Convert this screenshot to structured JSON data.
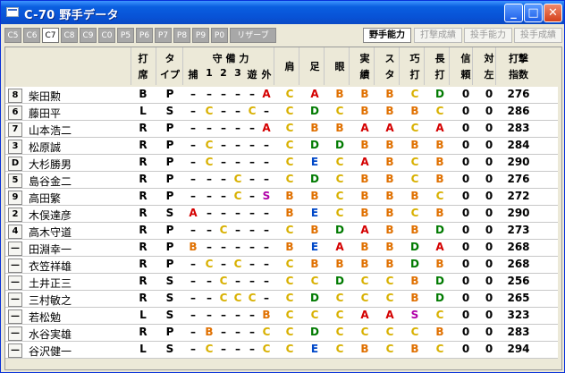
{
  "window": {
    "title": "C-70 野手データ"
  },
  "tabs": [
    "C5",
    "C6",
    "C7",
    "C8",
    "C9",
    "C0",
    "P5",
    "P6",
    "P7",
    "P8",
    "P9",
    "P0",
    "リザーブ"
  ],
  "active_tab": 2,
  "side_buttons": [
    {
      "label": "野手能力",
      "active": true
    },
    {
      "label": "打撃成績",
      "active": false
    },
    {
      "label": "投手能力",
      "active": false
    },
    {
      "label": "投手成績",
      "active": false
    }
  ],
  "headers": {
    "bat_top": "打",
    "bat_bottom": "席",
    "type_top": "タ",
    "type_bottom": "イプ",
    "pos_top": "守 備 力",
    "pos_cols": [
      "捕",
      "1",
      "2",
      "3",
      "遊",
      "外"
    ],
    "shoulder": "肩",
    "leg": "足",
    "eye": "眼",
    "record_top": "実",
    "record_bottom": "績",
    "stamina_top": "ス",
    "stamina_bottom": "タ",
    "skill_top": "巧",
    "skill_bottom": "打",
    "long_top": "長",
    "long_bottom": "打",
    "trust_top": "信",
    "trust_bottom": "頼",
    "vsleft_top": "対",
    "vsleft_bottom": "左",
    "index_top": "打撃",
    "index_bottom": "指数"
  },
  "players": [
    {
      "num": "8",
      "name": "柴田勲",
      "bat": "B",
      "type": "P",
      "pos": [
        "-",
        "-",
        "-",
        "-",
        "-",
        "A"
      ],
      "shoulder": "C",
      "leg": "A",
      "eye": "B",
      "record": "B",
      "stamina": "B",
      "skill": "C",
      "long": "D",
      "trust": "0",
      "vsleft": "0",
      "index": "276"
    },
    {
      "num": "6",
      "name": "藤田平",
      "bat": "L",
      "type": "S",
      "pos": [
        "-",
        "C",
        "-",
        "-",
        "C",
        "-"
      ],
      "shoulder": "C",
      "leg": "D",
      "eye": "C",
      "record": "B",
      "stamina": "B",
      "skill": "B",
      "long": "C",
      "trust": "0",
      "vsleft": "0",
      "index": "286"
    },
    {
      "num": "7",
      "name": "山本浩二",
      "bat": "R",
      "type": "P",
      "pos": [
        "-",
        "-",
        "-",
        "-",
        "-",
        "A"
      ],
      "shoulder": "C",
      "leg": "B",
      "eye": "B",
      "record": "A",
      "stamina": "A",
      "skill": "C",
      "long": "A",
      "trust": "0",
      "vsleft": "0",
      "index": "283"
    },
    {
      "num": "3",
      "name": "松原誠",
      "bat": "R",
      "type": "P",
      "pos": [
        "-",
        "C",
        "-",
        "-",
        "-",
        "-"
      ],
      "shoulder": "C",
      "leg": "D",
      "eye": "D",
      "record": "B",
      "stamina": "B",
      "skill": "B",
      "long": "B",
      "trust": "0",
      "vsleft": "0",
      "index": "284"
    },
    {
      "num": "D",
      "name": "大杉勝男",
      "bat": "R",
      "type": "P",
      "pos": [
        "-",
        "C",
        "-",
        "-",
        "-",
        "-"
      ],
      "shoulder": "C",
      "leg": "E",
      "eye": "C",
      "record": "A",
      "stamina": "B",
      "skill": "C",
      "long": "B",
      "trust": "0",
      "vsleft": "0",
      "index": "290"
    },
    {
      "num": "5",
      "name": "島谷金二",
      "bat": "R",
      "type": "P",
      "pos": [
        "-",
        "-",
        "-",
        "C",
        "-",
        "-"
      ],
      "shoulder": "C",
      "leg": "D",
      "eye": "C",
      "record": "B",
      "stamina": "B",
      "skill": "C",
      "long": "B",
      "trust": "0",
      "vsleft": "0",
      "index": "276"
    },
    {
      "num": "9",
      "name": "高田繁",
      "bat": "R",
      "type": "P",
      "pos": [
        "-",
        "-",
        "-",
        "C",
        "-",
        "S"
      ],
      "shoulder": "B",
      "leg": "B",
      "eye": "C",
      "record": "B",
      "stamina": "B",
      "skill": "B",
      "long": "C",
      "trust": "0",
      "vsleft": "0",
      "index": "272"
    },
    {
      "num": "2",
      "name": "木俣達彦",
      "bat": "R",
      "type": "S",
      "pos": [
        "A",
        "-",
        "-",
        "-",
        "-",
        "-"
      ],
      "shoulder": "B",
      "leg": "E",
      "eye": "C",
      "record": "B",
      "stamina": "B",
      "skill": "C",
      "long": "B",
      "trust": "0",
      "vsleft": "0",
      "index": "290"
    },
    {
      "num": "4",
      "name": "高木守道",
      "bat": "R",
      "type": "P",
      "pos": [
        "-",
        "-",
        "C",
        "-",
        "-",
        "-"
      ],
      "shoulder": "C",
      "leg": "B",
      "eye": "D",
      "record": "A",
      "stamina": "B",
      "skill": "B",
      "long": "D",
      "trust": "0",
      "vsleft": "0",
      "index": "273"
    },
    {
      "num": "—",
      "name": "田淵幸一",
      "bat": "R",
      "type": "P",
      "pos": [
        "B",
        "-",
        "-",
        "-",
        "-",
        "-"
      ],
      "shoulder": "B",
      "leg": "E",
      "eye": "A",
      "record": "B",
      "stamina": "B",
      "skill": "D",
      "long": "A",
      "trust": "0",
      "vsleft": "0",
      "index": "268"
    },
    {
      "num": "—",
      "name": "衣笠祥雄",
      "bat": "R",
      "type": "P",
      "pos": [
        "-",
        "C",
        "-",
        "C",
        "-",
        "-"
      ],
      "shoulder": "C",
      "leg": "B",
      "eye": "B",
      "record": "B",
      "stamina": "B",
      "skill": "D",
      "long": "B",
      "trust": "0",
      "vsleft": "0",
      "index": "268"
    },
    {
      "num": "—",
      "name": "土井正三",
      "bat": "R",
      "type": "S",
      "pos": [
        "-",
        "-",
        "C",
        "-",
        "-",
        "-"
      ],
      "shoulder": "C",
      "leg": "C",
      "eye": "D",
      "record": "C",
      "stamina": "C",
      "skill": "B",
      "long": "D",
      "trust": "0",
      "vsleft": "0",
      "index": "256"
    },
    {
      "num": "—",
      "name": "三村敏之",
      "bat": "R",
      "type": "S",
      "pos": [
        "-",
        "-",
        "C",
        "C",
        "C",
        "-"
      ],
      "shoulder": "C",
      "leg": "D",
      "eye": "C",
      "record": "C",
      "stamina": "C",
      "skill": "B",
      "long": "D",
      "trust": "0",
      "vsleft": "0",
      "index": "265"
    },
    {
      "num": "—",
      "name": "若松勉",
      "bat": "L",
      "type": "S",
      "pos": [
        "-",
        "-",
        "-",
        "-",
        "-",
        "B"
      ],
      "shoulder": "C",
      "leg": "C",
      "eye": "C",
      "record": "A",
      "stamina": "A",
      "skill": "S",
      "long": "C",
      "trust": "0",
      "vsleft": "0",
      "index": "323"
    },
    {
      "num": "—",
      "name": "水谷実雄",
      "bat": "R",
      "type": "P",
      "pos": [
        "-",
        "B",
        "-",
        "-",
        "-",
        "C"
      ],
      "shoulder": "C",
      "leg": "D",
      "eye": "C",
      "record": "C",
      "stamina": "C",
      "skill": "C",
      "long": "B",
      "trust": "0",
      "vsleft": "0",
      "index": "283"
    },
    {
      "num": "—",
      "name": "谷沢健一",
      "bat": "L",
      "type": "S",
      "pos": [
        "-",
        "C",
        "-",
        "-",
        "-",
        "C"
      ],
      "shoulder": "C",
      "leg": "E",
      "eye": "C",
      "record": "B",
      "stamina": "C",
      "skill": "B",
      "long": "C",
      "trust": "0",
      "vsleft": "0",
      "index": "294"
    }
  ],
  "colors": {
    "A": "#d40000",
    "B": "#e07000",
    "C": "#d8b000",
    "D": "#007a00",
    "E": "#0048c8",
    "S": "#b000a8"
  }
}
